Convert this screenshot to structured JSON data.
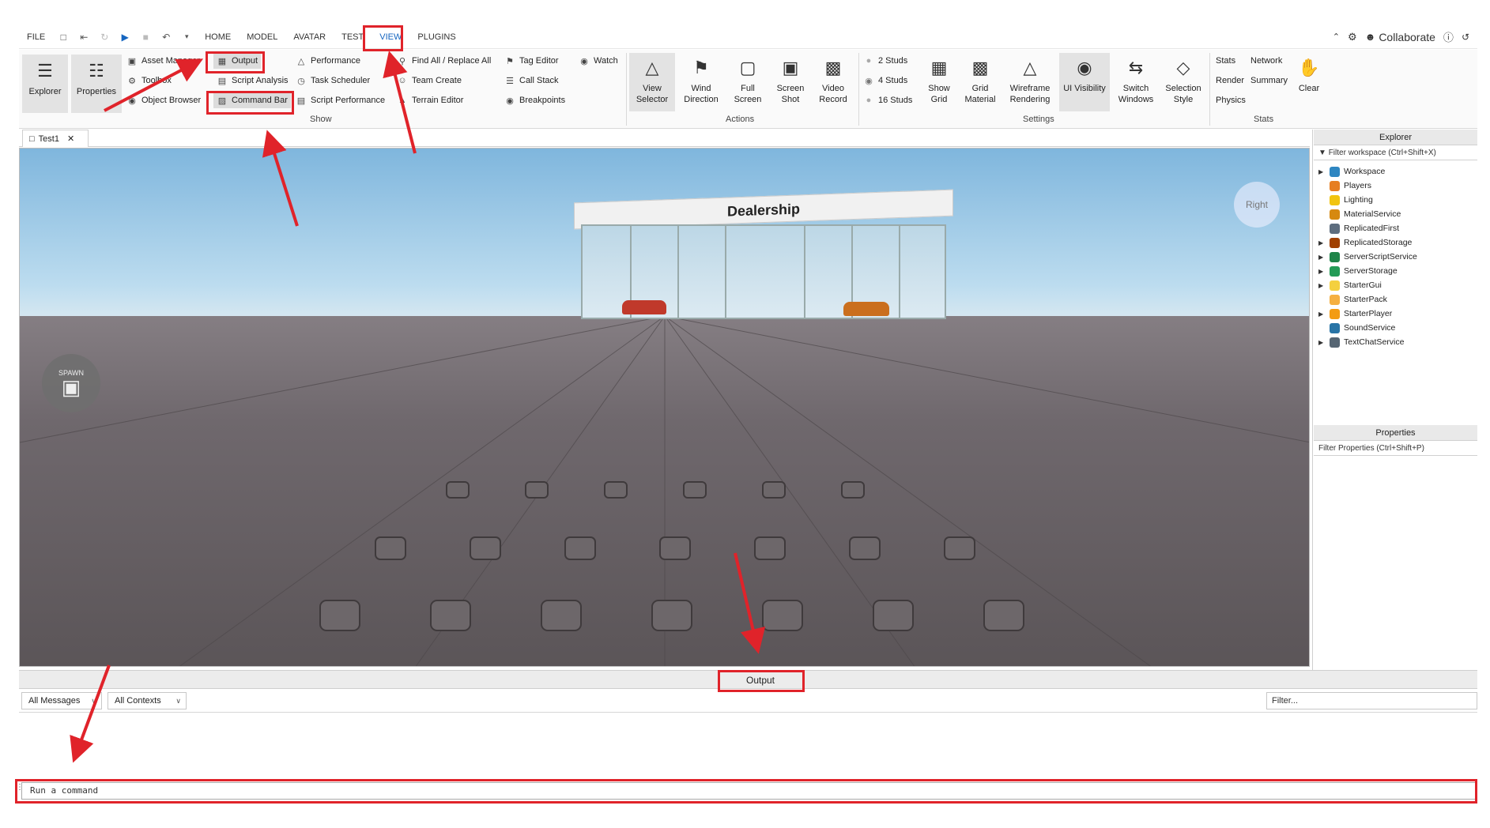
{
  "menubar": {
    "items": [
      "FILE",
      "HOME",
      "MODEL",
      "AVATAR",
      "TEST",
      "VIEW",
      "PLUGINS"
    ],
    "collaborate_label": "Collaborate"
  },
  "ribbon": {
    "show": {
      "label": "Show",
      "explorer": "Explorer",
      "properties": "Properties",
      "asset_manager": "Asset Manager",
      "toolbox": "Toolbox",
      "object_browser": "Object Browser",
      "output": "Output",
      "script_analysis": "Script Analysis",
      "command_bar": "Command Bar",
      "performance": "Performance",
      "task_scheduler": "Task Scheduler",
      "script_performance": "Script Performance",
      "find_all": "Find All / Replace All",
      "team_create": "Team Create",
      "terrain_editor": "Terrain Editor",
      "tag_editor": "Tag Editor",
      "call_stack": "Call Stack",
      "breakpoints": "Breakpoints",
      "watch": "Watch"
    },
    "actions": {
      "label": "Actions",
      "view_selector": [
        "View",
        "Selector"
      ],
      "wind_direction": [
        "Wind",
        "Direction"
      ],
      "full_screen": [
        "Full",
        "Screen"
      ],
      "screen_shot": [
        "Screen",
        "Shot"
      ],
      "video_record": [
        "Video",
        "Record"
      ]
    },
    "settings": {
      "label": "Settings",
      "studs_2": "2 Studs",
      "studs_4": "4 Studs",
      "studs_16": "16 Studs",
      "show_grid": [
        "Show",
        "Grid"
      ],
      "grid_material": [
        "Grid",
        "Material"
      ],
      "wireframe_rendering": [
        "Wireframe",
        "Rendering"
      ],
      "ui_visibility": "UI Visibility",
      "switch_windows": [
        "Switch",
        "Windows"
      ],
      "selection_style": [
        "Selection",
        "Style"
      ]
    },
    "stats": {
      "label": "Stats",
      "stats": "Stats",
      "network": "Network",
      "render": "Render",
      "summary": "Summary",
      "physics": "Physics",
      "clear": "Clear"
    }
  },
  "document_tab": "Test1",
  "viewport": {
    "building_sign": "Dealership",
    "compass_label": "Right",
    "spawn_label": "SPAWN"
  },
  "explorer": {
    "title": "Explorer",
    "filter_placeholder": "Filter workspace (Ctrl+Shift+X)",
    "items": [
      {
        "label": "Workspace",
        "color": "#2e86c1",
        "expandable": true
      },
      {
        "label": "Players",
        "color": "#e67e22",
        "expandable": false
      },
      {
        "label": "Lighting",
        "color": "#f1c40f",
        "expandable": false
      },
      {
        "label": "MaterialService",
        "color": "#d68910",
        "expandable": false
      },
      {
        "label": "ReplicatedFirst",
        "color": "#5d6d7e",
        "expandable": false
      },
      {
        "label": "ReplicatedStorage",
        "color": "#a04000",
        "expandable": true
      },
      {
        "label": "ServerScriptService",
        "color": "#1e8449",
        "expandable": true
      },
      {
        "label": "ServerStorage",
        "color": "#239b56",
        "expandable": true
      },
      {
        "label": "StarterGui",
        "color": "#f4d03f",
        "expandable": true
      },
      {
        "label": "StarterPack",
        "color": "#f5b041",
        "expandable": false
      },
      {
        "label": "StarterPlayer",
        "color": "#f39c12",
        "expandable": true
      },
      {
        "label": "SoundService",
        "color": "#2874a6",
        "expandable": false
      },
      {
        "label": "TextChatService",
        "color": "#566573",
        "expandable": true
      }
    ]
  },
  "properties": {
    "title": "Properties",
    "filter_placeholder": "Filter Properties (Ctrl+Shift+P)"
  },
  "output": {
    "title": "Output",
    "messages_dropdown": "All Messages",
    "contexts_dropdown": "All Contexts",
    "filter_placeholder": "Filter...",
    "command_placeholder": "Run a command"
  },
  "colors": {
    "highlight": "#e0232a",
    "accent": "#1565c0"
  }
}
